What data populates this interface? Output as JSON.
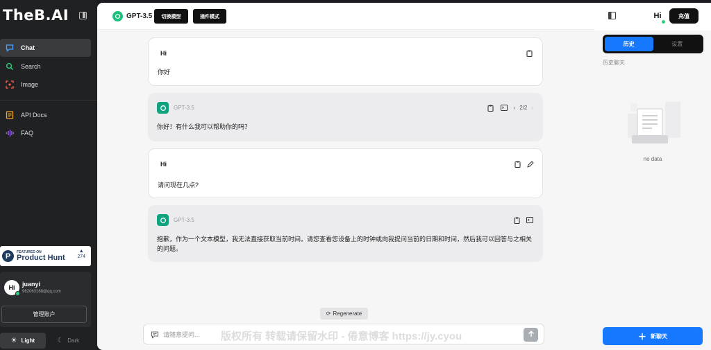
{
  "brand": {
    "logo": "TheB.AI"
  },
  "nav": {
    "items": [
      {
        "label": "Chat",
        "icon": "chat-bubble-icon",
        "active": true
      },
      {
        "label": "Search",
        "icon": "search-icon"
      },
      {
        "label": "Image",
        "icon": "image-scan-icon"
      },
      {
        "label": "API Docs",
        "icon": "document-icon"
      },
      {
        "label": "FAQ",
        "icon": "audio-wave-icon"
      }
    ]
  },
  "product_hunt": {
    "featured": "FEATURED ON",
    "name": "Product Hunt",
    "votes": "274"
  },
  "user": {
    "name": "juanyi",
    "email": "962063168@qq.com",
    "avatar": "Hi",
    "manage_label": "管理账户"
  },
  "theme": {
    "light": "Light",
    "dark": "Dark"
  },
  "topbar": {
    "model": "GPT-3.5",
    "switch_model": "切换模型",
    "plugin_mode": "插件模式"
  },
  "messages": [
    {
      "role": "user",
      "who": "Hi",
      "text": "你好"
    },
    {
      "role": "assistant",
      "model": "GPT-3.5",
      "text": "你好！有什么我可以帮助你的吗？",
      "pager": "2/2"
    },
    {
      "role": "user",
      "who": "Hi",
      "text": "请问现在几点?"
    },
    {
      "role": "assistant",
      "model": "GPT-3.5",
      "text": "抱歉，作为一个文本模型，我无法直接获取当前时间。请您查看您设备上的时钟或向我提问当前的日期和时间，然后我可以回答与之相关的问题。"
    }
  ],
  "regenerate": "Regenerate",
  "input": {
    "placeholder": "请随意提问..."
  },
  "watermark": "版权所有 转载请保留水印 - 倦意博客 https://jy.cyou",
  "right": {
    "avatar": "Hi",
    "recharge": "充值",
    "tab_history": "历史",
    "tab_settings": "设置",
    "history_label": "历史聊天",
    "empty": "no data",
    "new_chat": "新聊天"
  },
  "colors": {
    "accent": "#1677ff",
    "sidebar": "#202123",
    "gpt_green": "#10a37f",
    "online": "#2bd17e"
  }
}
